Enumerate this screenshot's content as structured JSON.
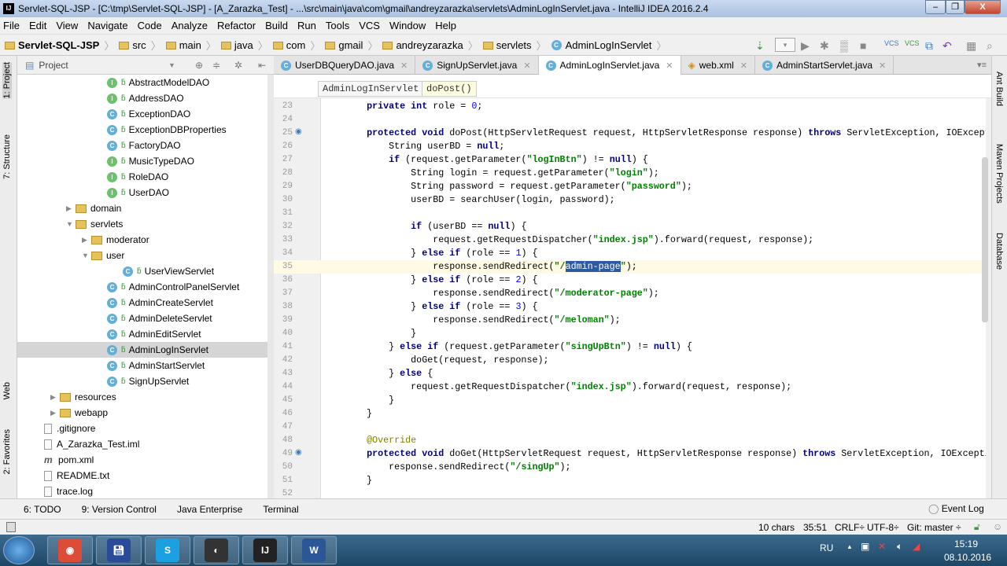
{
  "window": {
    "title": "Servlet-SQL-JSP - [C:\\tmp\\Servlet-SQL-JSP] - [A_Zarazka_Test] - ...\\src\\main\\java\\com\\gmail\\andreyzarazka\\servlets\\AdminLogInServlet.java - IntelliJ IDEA 2016.2.4"
  },
  "menu": [
    "File",
    "Edit",
    "View",
    "Navigate",
    "Code",
    "Analyze",
    "Refactor",
    "Build",
    "Run",
    "Tools",
    "VCS",
    "Window",
    "Help"
  ],
  "breadcrumb": [
    "Servlet-SQL-JSP",
    "src",
    "main",
    "java",
    "com",
    "gmail",
    "andreyzarazka",
    "servlets",
    "AdminLogInServlet"
  ],
  "left_tabs": {
    "project": "1: Project",
    "structure": "7: Structure",
    "web": "Web",
    "favorites": "2: Favorites"
  },
  "right_tabs": {
    "ant": "Ant Build",
    "maven": "Maven Projects",
    "database": "Database"
  },
  "project_panel": {
    "title": "Project"
  },
  "tree": [
    {
      "label": "AbstractModelDAO",
      "icon": "I",
      "indent": 6
    },
    {
      "label": "AddressDAO",
      "icon": "I",
      "indent": 6
    },
    {
      "label": "ExceptionDAO",
      "icon": "C",
      "indent": 6
    },
    {
      "label": "ExceptionDBProperties",
      "icon": "C",
      "indent": 6
    },
    {
      "label": "FactoryDAO",
      "icon": "C",
      "indent": 6
    },
    {
      "label": "MusicTypeDAO",
      "icon": "I",
      "indent": 6
    },
    {
      "label": "RoleDAO",
      "icon": "I",
      "indent": 6
    },
    {
      "label": "UserDAO",
      "icon": "I",
      "indent": 6
    },
    {
      "label": "domain",
      "icon": "folder",
      "indent": 4,
      "arrow": "▶"
    },
    {
      "label": "servlets",
      "icon": "folder",
      "indent": 4,
      "arrow": "▼"
    },
    {
      "label": "moderator",
      "icon": "folder",
      "indent": 5,
      "arrow": "▶"
    },
    {
      "label": "user",
      "icon": "folder",
      "indent": 5,
      "arrow": "▼"
    },
    {
      "label": "UserViewServlet",
      "icon": "C",
      "indent": 7
    },
    {
      "label": "AdminControlPanelServlet",
      "icon": "C",
      "indent": 6
    },
    {
      "label": "AdminCreateServlet",
      "icon": "C",
      "indent": 6
    },
    {
      "label": "AdminDeleteServlet",
      "icon": "C",
      "indent": 6
    },
    {
      "label": "AdminEditServlet",
      "icon": "C",
      "indent": 6
    },
    {
      "label": "AdminLogInServlet",
      "icon": "C",
      "indent": 6,
      "selected": true
    },
    {
      "label": "AdminStartServlet",
      "icon": "C",
      "indent": 6
    },
    {
      "label": "SignUpServlet",
      "icon": "C",
      "indent": 6
    },
    {
      "label": "resources",
      "icon": "folder",
      "indent": 3,
      "arrow": "▶"
    },
    {
      "label": "webapp",
      "icon": "folder",
      "indent": 3,
      "arrow": "▶"
    },
    {
      "label": ".gitignore",
      "icon": "file",
      "indent": 2
    },
    {
      "label": "A_Zarazka_Test.iml",
      "icon": "file",
      "indent": 2
    },
    {
      "label": "pom.xml",
      "icon": "m",
      "indent": 2
    },
    {
      "label": "README.txt",
      "icon": "file",
      "indent": 2
    },
    {
      "label": "trace.log",
      "icon": "file",
      "indent": 2
    }
  ],
  "tabs": [
    {
      "label": "UserDBQueryDAO.java"
    },
    {
      "label": "SignUpServlet.java"
    },
    {
      "label": "AdminLogInServlet.java",
      "active": true
    },
    {
      "label": "web.xml"
    },
    {
      "label": "AdminStartServlet.java"
    }
  ],
  "editor_breadcrumb": {
    "class": "AdminLogInServlet",
    "method": "doPost()"
  },
  "code": [
    {
      "n": 23,
      "t": [
        [
          "",
          "    "
        ],
        [
          "kw",
          "private int"
        ],
        [
          "",
          " role = "
        ],
        [
          "nu",
          "0"
        ],
        [
          "",
          ";"
        ]
      ]
    },
    {
      "n": 24,
      "t": []
    },
    {
      "n": 25,
      "t": [
        [
          "",
          "    "
        ],
        [
          "kw",
          "protected void"
        ],
        [
          "",
          " doPost(HttpServletRequest request, HttpServletResponse response) "
        ],
        [
          "kw",
          "throws"
        ],
        [
          "",
          " ServletException, IOException {"
        ]
      ]
    },
    {
      "n": 26,
      "t": [
        [
          "",
          "        String userBD = "
        ],
        [
          "kw",
          "null"
        ],
        [
          "",
          ";"
        ]
      ]
    },
    {
      "n": 27,
      "t": [
        [
          "",
          "        "
        ],
        [
          "kw",
          "if"
        ],
        [
          "",
          " (request.getParameter("
        ],
        [
          "st",
          "\"logInBtn\""
        ],
        [
          "",
          ") != "
        ],
        [
          "kw",
          "null"
        ],
        [
          "",
          ") {"
        ]
      ]
    },
    {
      "n": 28,
      "t": [
        [
          "",
          "            String login = request.getParameter("
        ],
        [
          "st",
          "\"login\""
        ],
        [
          "",
          ");"
        ]
      ]
    },
    {
      "n": 29,
      "t": [
        [
          "",
          "            String password = request.getParameter("
        ],
        [
          "st",
          "\"password\""
        ],
        [
          "",
          ");"
        ]
      ]
    },
    {
      "n": 30,
      "t": [
        [
          "",
          "            userBD = searchUser(login, password);"
        ]
      ]
    },
    {
      "n": 31,
      "t": []
    },
    {
      "n": 32,
      "t": [
        [
          "",
          "            "
        ],
        [
          "kw",
          "if"
        ],
        [
          "",
          " (userBD == "
        ],
        [
          "kw",
          "null"
        ],
        [
          "",
          ") {"
        ]
      ]
    },
    {
      "n": 33,
      "t": [
        [
          "",
          "                request.getRequestDispatcher("
        ],
        [
          "st",
          "\"index.jsp\""
        ],
        [
          "",
          ").forward(request, response);"
        ]
      ]
    },
    {
      "n": 34,
      "t": [
        [
          "",
          "            } "
        ],
        [
          "kw",
          "else if"
        ],
        [
          "",
          " (role == "
        ],
        [
          "nu",
          "1"
        ],
        [
          "",
          ") {"
        ]
      ]
    },
    {
      "n": 35,
      "t": [
        [
          "",
          "                response.sendRedirect("
        ],
        [
          "st",
          "\"/"
        ],
        [
          "hl",
          "admin-page"
        ],
        [
          "st",
          "\""
        ],
        [
          "",
          ");"
        ]
      ],
      "current": true
    },
    {
      "n": 36,
      "t": [
        [
          "",
          "            } "
        ],
        [
          "kw",
          "else if"
        ],
        [
          "",
          " (role == "
        ],
        [
          "nu",
          "2"
        ],
        [
          "",
          ") {"
        ]
      ]
    },
    {
      "n": 37,
      "t": [
        [
          "",
          "                response.sendRedirect("
        ],
        [
          "st",
          "\"/moderator-page\""
        ],
        [
          "",
          ");"
        ]
      ]
    },
    {
      "n": 38,
      "t": [
        [
          "",
          "            } "
        ],
        [
          "kw",
          "else if"
        ],
        [
          "",
          " (role == "
        ],
        [
          "nu",
          "3"
        ],
        [
          "",
          ") {"
        ]
      ]
    },
    {
      "n": 39,
      "t": [
        [
          "",
          "                response.sendRedirect("
        ],
        [
          "st",
          "\"/meloman\""
        ],
        [
          "",
          ");"
        ]
      ]
    },
    {
      "n": 40,
      "t": [
        [
          "",
          "            }"
        ]
      ]
    },
    {
      "n": 41,
      "t": [
        [
          "",
          "        } "
        ],
        [
          "kw",
          "else if"
        ],
        [
          "",
          " (request.getParameter("
        ],
        [
          "st",
          "\"singUpBtn\""
        ],
        [
          "",
          ") != "
        ],
        [
          "kw",
          "null"
        ],
        [
          "",
          ") {"
        ]
      ]
    },
    {
      "n": 42,
      "t": [
        [
          "",
          "            doGet(request, response);"
        ]
      ]
    },
    {
      "n": 43,
      "t": [
        [
          "",
          "        } "
        ],
        [
          "kw",
          "else"
        ],
        [
          "",
          " {"
        ]
      ]
    },
    {
      "n": 44,
      "t": [
        [
          "",
          "            request.getRequestDispatcher("
        ],
        [
          "st",
          "\"index.jsp\""
        ],
        [
          "",
          ").forward(request, response);"
        ]
      ]
    },
    {
      "n": 45,
      "t": [
        [
          "",
          "        }"
        ]
      ]
    },
    {
      "n": 46,
      "t": [
        [
          "",
          "    }"
        ]
      ]
    },
    {
      "n": 47,
      "t": []
    },
    {
      "n": 48,
      "t": [
        [
          "",
          "    "
        ],
        [
          "an",
          "@Override"
        ]
      ]
    },
    {
      "n": 49,
      "t": [
        [
          "",
          "    "
        ],
        [
          "kw",
          "protected void"
        ],
        [
          "",
          " doGet(HttpServletRequest request, HttpServletResponse response) "
        ],
        [
          "kw",
          "throws"
        ],
        [
          "",
          " ServletException, IOException {"
        ]
      ]
    },
    {
      "n": 50,
      "t": [
        [
          "",
          "        response.sendRedirect("
        ],
        [
          "st",
          "\"/singUp\""
        ],
        [
          "",
          ");"
        ]
      ]
    },
    {
      "n": 51,
      "t": [
        [
          "",
          "    }"
        ]
      ]
    },
    {
      "n": 52,
      "t": []
    }
  ],
  "toolwindows": [
    "6: TODO",
    "9: Version Control",
    "Java Enterprise",
    "Terminal"
  ],
  "event_log": "Event Log",
  "status": {
    "selection": "10 chars",
    "position": "35:51",
    "line_sep": "CRLF÷",
    "encoding": "UTF-8÷",
    "git": "Git: master ÷"
  },
  "taskbar": {
    "lang": "RU",
    "time": "15:19",
    "date": "08.10.2016",
    "apps": [
      "Chrome",
      "Floppy",
      "Skype",
      "OBS",
      "IJ",
      "W"
    ]
  }
}
